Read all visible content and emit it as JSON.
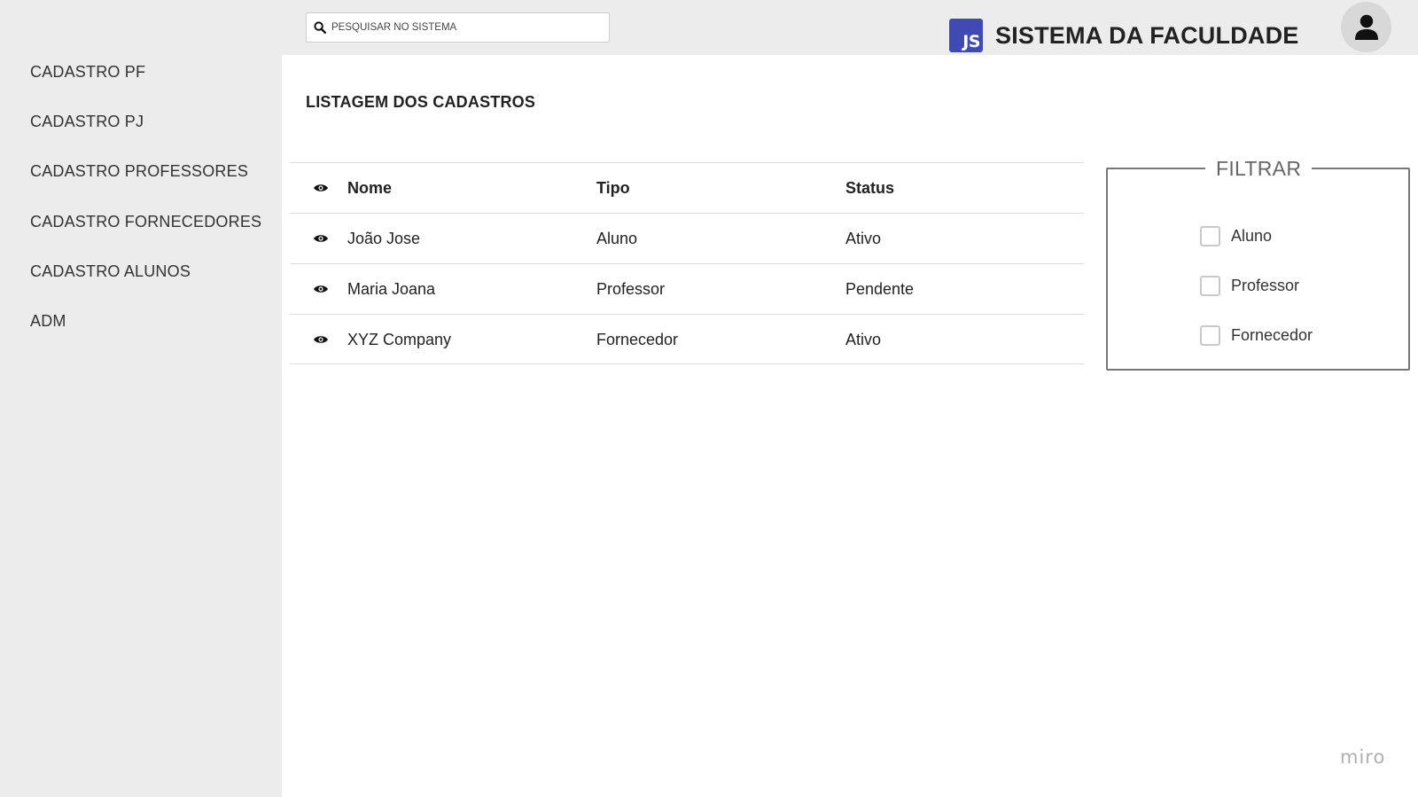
{
  "header": {
    "search": {
      "placeholder": "PESQUISAR NO SISTEMA",
      "value": ""
    },
    "brand": {
      "logo_text": "JS",
      "title": "SISTEMA DA FACULDADE"
    },
    "icons": {
      "search": "search-icon",
      "avatar": "user-icon"
    }
  },
  "sidebar": {
    "items": [
      {
        "label": "CADASTRO PF"
      },
      {
        "label": "CADASTRO PJ"
      },
      {
        "label": "CADASTRO PROFESSORES"
      },
      {
        "label": "CADASTRO FORNECEDORES"
      },
      {
        "label": "CADASTRO ALUNOS"
      },
      {
        "label": "ADM"
      }
    ]
  },
  "main": {
    "title": "LISTAGEM DOS CADASTROS",
    "table": {
      "columns": [
        "Nome",
        "Tipo",
        "Status"
      ],
      "rows": [
        {
          "nome": "João Jose",
          "tipo": "Aluno",
          "status": "Ativo"
        },
        {
          "nome": "Maria Joana",
          "tipo": "Professor",
          "status": "Pendente"
        },
        {
          "nome": "XYZ Company",
          "tipo": "Fornecedor",
          "status": "Ativo"
        }
      ]
    },
    "filter": {
      "title": "FILTRAR",
      "options": [
        {
          "label": "Aluno",
          "checked": false
        },
        {
          "label": "Professor",
          "checked": false
        },
        {
          "label": "Fornecedor",
          "checked": false
        }
      ]
    }
  },
  "watermark": "miro",
  "colors": {
    "brand": "#3f4bb3",
    "sidebar_bg": "#ececec",
    "main_bg": "#ffffff"
  }
}
